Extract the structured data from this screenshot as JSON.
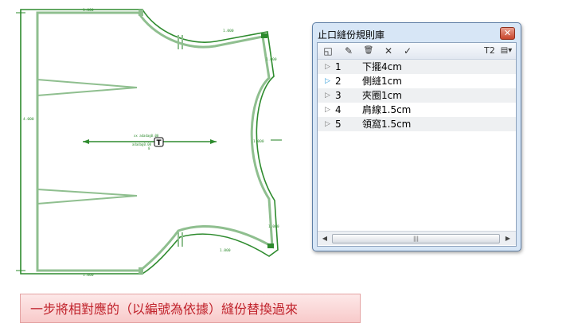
{
  "drawing": {
    "dimensions": {
      "top": "1.000",
      "bottom": "1.000",
      "left": "4.000",
      "shoulder_top": "1.000",
      "side_upper": "1.000",
      "armhole": "1.000",
      "side_lower": "1.000",
      "shoulder_bottom": "1.000"
    },
    "center_text": [
      "xx adadag0.00",
      "adadag0.00"
    ],
    "center_zero": "0",
    "center_icon": "T",
    "colors": {
      "dark": "#2e8b2e",
      "light": "#8fbf8f"
    }
  },
  "dialog": {
    "title": "止口縫份規則庫",
    "close_label": "✕",
    "toolbar": {
      "new_icon": "◱",
      "edit_icon": "✎",
      "delete_icon": "🗑",
      "cancel_icon": "✕",
      "ok_icon": "✓",
      "t2_label": "T2",
      "list_icon": "▤▾"
    },
    "rows": [
      {
        "num": "1",
        "name": "下擺4cm"
      },
      {
        "num": "2",
        "name": "側縫1cm"
      },
      {
        "num": "3",
        "name": "夾圈1cm"
      },
      {
        "num": "4",
        "name": "肩線1.5cm"
      },
      {
        "num": "5",
        "name": "領窩1.5cm"
      }
    ],
    "selected_row": 1,
    "scrollbar": {
      "left": "◀",
      "right": "▶",
      "grip": "|||"
    }
  },
  "caption": "一步將相對應的（以編號為依據）縫份替換過來"
}
